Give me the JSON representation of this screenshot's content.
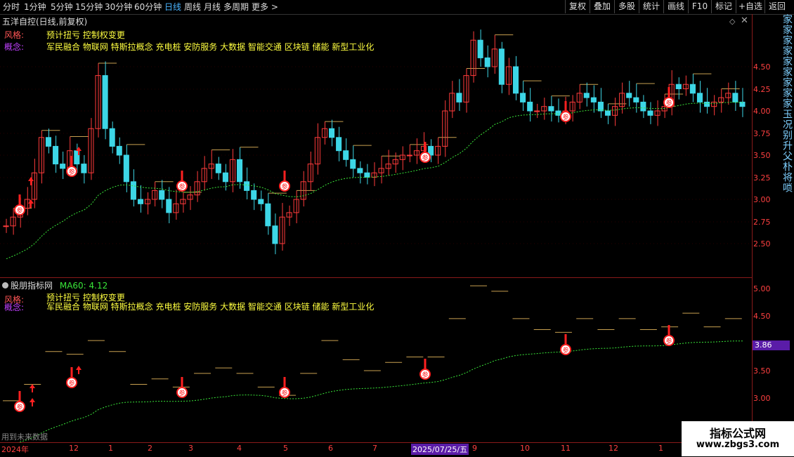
{
  "toolbar": {
    "timeframes": [
      "分时",
      "1分钟",
      "5分钟",
      "15分钟",
      "30分钟",
      "60分钟",
      "日线",
      "周线",
      "月线",
      "多周期",
      "更多 >"
    ],
    "active_timeframe": "日线",
    "right_buttons": [
      "复权",
      "叠加",
      "多股",
      "统计",
      "画线",
      "F10",
      "标记",
      "+自选",
      "返回"
    ]
  },
  "main_panel": {
    "title": "五洋自控(日线,前复权)",
    "style_label": "风格:",
    "style_value": "预计扭亏 控制权变更",
    "concept_label": "概念:",
    "concept_value": "军民融合 物联网 特斯拉概念 充电桩 安防服务 大数据 智能交通 区块链 储能 新型工业化",
    "y_ticks": [
      "4.50",
      "4.25",
      "4.00",
      "3.75",
      "3.50",
      "3.25",
      "3.00",
      "2.75",
      "2.50"
    ]
  },
  "sub_panel": {
    "title": "股朋指标网",
    "ma_label": "MA60: 4.12",
    "style_label": "风格:",
    "style_value": "预计扭亏 控制权变更",
    "concept_label": "概念:",
    "concept_value": "军民融合 物联网 特斯拉概念 充电桩 安防服务 大数据 智能交通 区块链 储能 新型工业化",
    "y_ticks": [
      "5.00",
      "4.50",
      "3.50",
      "3.00"
    ],
    "current_price_tag": "3.86",
    "future_note": "用到未来数据"
  },
  "x_axis": {
    "labels": [
      "2024年",
      "12",
      "1",
      "2",
      "3",
      "4",
      "5",
      "6",
      "7",
      "2025/07/25/五",
      "9",
      "10",
      "11",
      "12",
      "1"
    ],
    "highlight": "2025/07/25/五"
  },
  "side_strip": "家家家家家家家家家玉况别升父朴将唢",
  "watermark": {
    "line1": "指标公式网",
    "line2": "www.zbgs3.com"
  },
  "colors": {
    "up": "#ff3b3b",
    "down": "#3dd6e6",
    "ma": "#39e639",
    "level": "#c8a050",
    "signal": "#ff2020"
  },
  "signal_marker": "参"
}
